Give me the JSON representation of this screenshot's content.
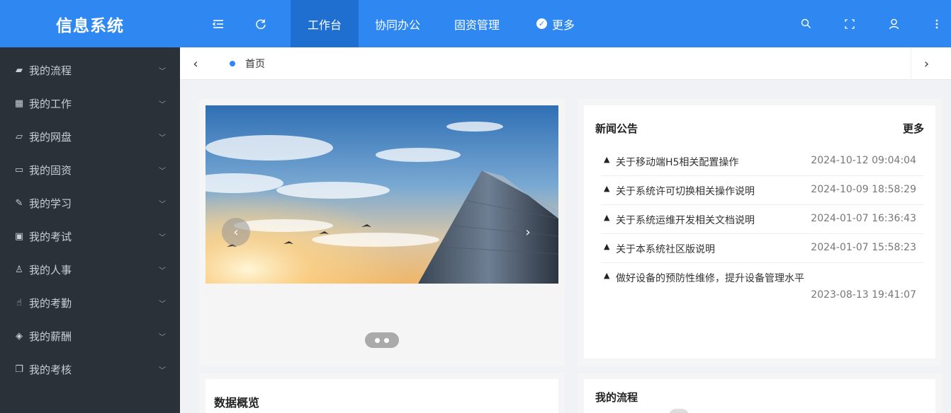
{
  "header": {
    "brand": "信息系统",
    "icons": [
      "menu-fold-icon",
      "refresh-icon",
      "search-icon",
      "fullscreen-icon",
      "user-icon",
      "more-vertical-icon"
    ],
    "nav": [
      {
        "label": "工作台",
        "active": true
      },
      {
        "label": "协同办公",
        "active": false
      },
      {
        "label": "固资管理",
        "active": false
      },
      {
        "label": "更多",
        "active": false
      }
    ]
  },
  "sidebar": {
    "items": [
      {
        "label": "我的流程",
        "icon": "book-icon"
      },
      {
        "label": "我的工作",
        "icon": "calendar-icon"
      },
      {
        "label": "我的网盘",
        "icon": "folder-open-icon"
      },
      {
        "label": "我的固资",
        "icon": "credit-card-icon"
      },
      {
        "label": "我的学习",
        "icon": "edit-icon"
      },
      {
        "label": "我的考试",
        "icon": "exam-icon"
      },
      {
        "label": "我的人事",
        "icon": "person-icon"
      },
      {
        "label": "我的考勤",
        "icon": "hand-pointer-icon"
      },
      {
        "label": "我的薪酬",
        "icon": "diamond-icon"
      },
      {
        "label": "我的考核",
        "icon": "copy-icon"
      }
    ]
  },
  "tabs": {
    "home": "首页"
  },
  "carousel": {
    "slide_count": 2,
    "active_index": 0
  },
  "news": {
    "title": "新闻公告",
    "more": "更多",
    "items": [
      {
        "title": "关于移动端H5相关配置操作",
        "date": "2024-10-12 09:04:04"
      },
      {
        "title": "关于系统许可切换相关操作说明",
        "date": "2024-10-09 18:58:29"
      },
      {
        "title": "关于系统运维开发相关文档说明",
        "date": "2024-01-07 16:36:43"
      },
      {
        "title": "关于本系统社区版说明",
        "date": "2024-01-07 15:58:23"
      },
      {
        "title": "做好设备的预防性维修，提升设备管理水平",
        "date": "2023-08-13 19:41:07"
      }
    ]
  },
  "overview": {
    "title": "数据概览"
  },
  "myflow": {
    "title": "我的流程"
  },
  "colors": {
    "header": "#2f88f2",
    "sidebar": "#2b3139",
    "active_nav": "#1f6fd0"
  }
}
